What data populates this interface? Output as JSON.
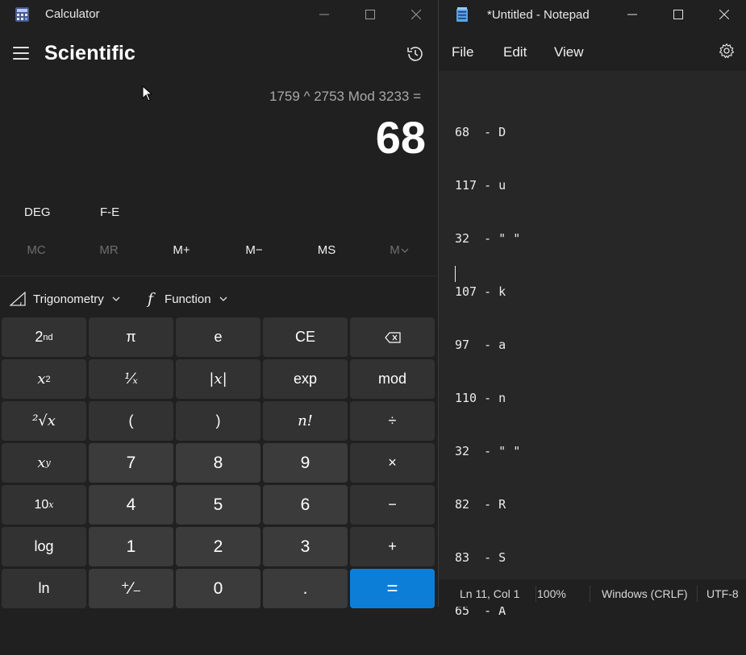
{
  "calculator": {
    "title": "Calculator",
    "mode": "Scientific",
    "expression": "1759 ^ 2753 Mod 3233 =",
    "display": "68",
    "angle_unit": "DEG",
    "notation": "F-E",
    "memory": [
      "MC",
      "MR",
      "M+",
      "M−",
      "MS",
      "M"
    ],
    "dropdowns": {
      "trig": "Trigonometry",
      "func": "Function"
    },
    "keys": {
      "second": "2",
      "second_sup": "nd",
      "pi": "π",
      "e": "e",
      "ce": "CE",
      "back": "⌫",
      "sq": "x",
      "sq_sup": "2",
      "inv": "¹⁄ₓ",
      "abs": "|x|",
      "exp": "exp",
      "mod": "mod",
      "root2": "²√x",
      "lparen": "(",
      "rparen": ")",
      "fact": "n!",
      "div": "÷",
      "pow": "x",
      "pow_sup": "y",
      "n7": "7",
      "n8": "8",
      "n9": "9",
      "mul": "×",
      "ten": "10",
      "ten_sup": "x",
      "n4": "4",
      "n5": "5",
      "n6": "6",
      "minus": "−",
      "log": "log",
      "n1": "1",
      "n2": "2",
      "n3": "3",
      "plus": "+",
      "ln": "ln",
      "neg": "⁺∕₋",
      "n0": "0",
      "dot": ".",
      "eq": "="
    },
    "accent_color": "#0d7ed8"
  },
  "notepad": {
    "title": "*Untitled - Notepad",
    "menu": [
      "File",
      "Edit",
      "View"
    ],
    "lines": [
      "68  - D",
      "117 - u",
      "32  - \" \"",
      "107 - k",
      "97  - a",
      "110 - n",
      "32  - \" \"",
      "82  - R",
      "83  - S",
      "65  - A"
    ],
    "status": {
      "position": "Ln 11, Col 1",
      "zoom": "100%",
      "line_ending": "Windows (CRLF)",
      "encoding": "UTF-8"
    }
  }
}
